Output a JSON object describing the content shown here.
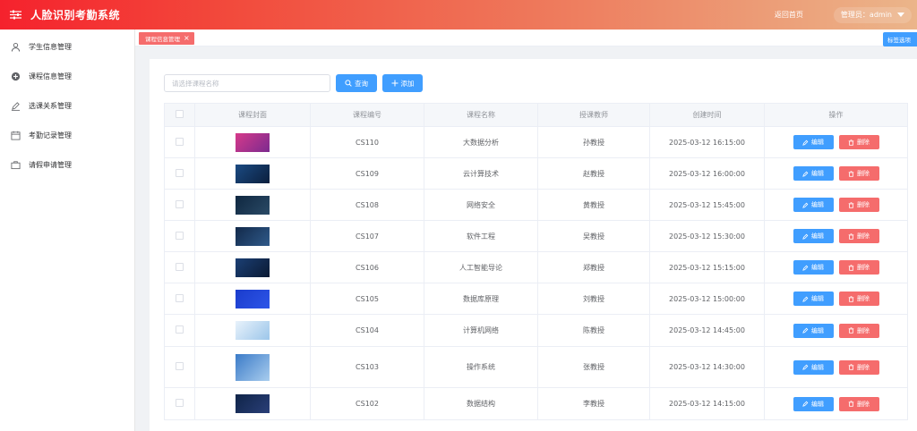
{
  "app": {
    "title": "人脸识别考勤系统"
  },
  "header": {
    "home_label": "返回首页",
    "admin_label": "管理员：admin"
  },
  "sidebar": {
    "items": [
      {
        "label": "学生信息管理",
        "icon": "user-icon"
      },
      {
        "label": "课程信息管理",
        "icon": "plus-circle-icon"
      },
      {
        "label": "选课关系管理",
        "icon": "pen-icon"
      },
      {
        "label": "考勤记录管理",
        "icon": "calendar-icon"
      },
      {
        "label": "请假申请管理",
        "icon": "briefcase-icon"
      }
    ]
  },
  "tags": {
    "active_tag": "课程信息管理",
    "close_glyph": "×",
    "options_label": "标签选项"
  },
  "toolbar": {
    "search_placeholder": "请选择课程名称",
    "search_label": "查询",
    "add_label": "添加"
  },
  "table": {
    "columns": [
      "课程封面",
      "课程编号",
      "课程名称",
      "授课教师",
      "创建时间",
      "操作"
    ],
    "edit_label": "编辑",
    "delete_label": "删除",
    "rows": [
      {
        "code": "CS110",
        "name": "大数据分析",
        "teacher": "孙教授",
        "created": "2025-03-12 16:15:00",
        "thumb": [
          "#d63a8a",
          "#7b2a8f"
        ]
      },
      {
        "code": "CS109",
        "name": "云计算技术",
        "teacher": "赵教授",
        "created": "2025-03-12 16:00:00",
        "thumb": [
          "#1b4a82",
          "#0b1f3d"
        ]
      },
      {
        "code": "CS108",
        "name": "网络安全",
        "teacher": "黄教授",
        "created": "2025-03-12 15:45:00",
        "thumb": [
          "#0f2740",
          "#2a4a66"
        ]
      },
      {
        "code": "CS107",
        "name": "软件工程",
        "teacher": "吴教授",
        "created": "2025-03-12 15:30:00",
        "thumb": [
          "#12294a",
          "#305a8a"
        ]
      },
      {
        "code": "CS106",
        "name": "人工智能导论",
        "teacher": "郑教授",
        "created": "2025-03-12 15:15:00",
        "thumb": [
          "#1b3f74",
          "#0b1a33"
        ]
      },
      {
        "code": "CS105",
        "name": "数据库原理",
        "teacher": "刘教授",
        "created": "2025-03-12 15:00:00",
        "thumb": [
          "#1a3ccc",
          "#2d55e8"
        ]
      },
      {
        "code": "CS104",
        "name": "计算机网络",
        "teacher": "陈教授",
        "created": "2025-03-12 14:45:00",
        "thumb": [
          "#e8f2fb",
          "#9cc6ea"
        ]
      },
      {
        "code": "CS103",
        "name": "操作系统",
        "teacher": "张教授",
        "created": "2025-03-12 14:30:00",
        "thumb": [
          "#3b7bc8",
          "#a9cdee"
        ]
      },
      {
        "code": "CS102",
        "name": "数据结构",
        "teacher": "李教授",
        "created": "2025-03-12 14:15:00",
        "thumb": [
          "#0f2448",
          "#2a3f78"
        ]
      }
    ]
  },
  "colors": {
    "primary": "#409eff",
    "danger": "#f56c6c",
    "header_start": "#f5222d",
    "header_end": "#ebb58a"
  }
}
